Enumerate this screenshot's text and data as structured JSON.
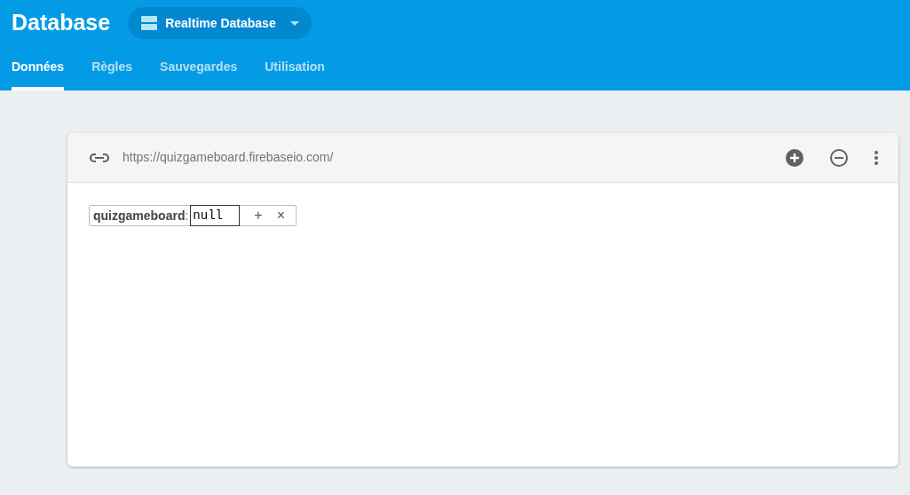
{
  "header": {
    "title": "Database",
    "selector": {
      "label": "Realtime Database"
    }
  },
  "tabs": [
    {
      "label": "Données",
      "selected": true
    },
    {
      "label": "Règles",
      "selected": false
    },
    {
      "label": "Sauvegardes",
      "selected": false
    },
    {
      "label": "Utilisation",
      "selected": false
    }
  ],
  "card": {
    "url": "https://quizgameboard.firebaseio.com/",
    "node": {
      "key": "quizgameboard",
      "separator": ":",
      "value": "null",
      "add": "+",
      "remove": "×"
    }
  }
}
